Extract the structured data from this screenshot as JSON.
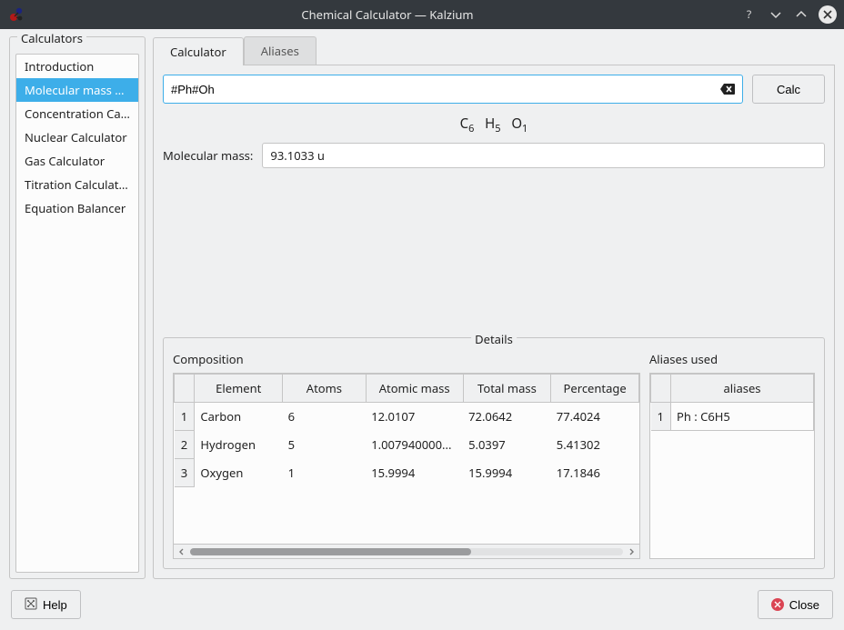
{
  "window": {
    "title": "Chemical Calculator — Kalzium"
  },
  "sidebar": {
    "group_label": "Calculators",
    "items": [
      {
        "label": "Introduction"
      },
      {
        "label": "Molecular mass Calc..."
      },
      {
        "label": "Concentration Calcul..."
      },
      {
        "label": "Nuclear Calculator"
      },
      {
        "label": "Gas Calculator"
      },
      {
        "label": "Titration Calculator"
      },
      {
        "label": "Equation Balancer"
      }
    ],
    "selected_index": 1
  },
  "tabs": {
    "items": [
      {
        "label": "Calculator"
      },
      {
        "label": "Aliases"
      }
    ],
    "active_index": 0
  },
  "calculator": {
    "input_value": "#Ph#Oh",
    "calc_button": "Calc",
    "formula_parts": [
      {
        "sym": "C",
        "sub": "6"
      },
      {
        "sym": "H",
        "sub": "5"
      },
      {
        "sym": "O",
        "sub": "1"
      }
    ],
    "mass_label": "Molecular mass:",
    "mass_value": "93.1033 u"
  },
  "details": {
    "group_label": "Details",
    "composition_label": "Composition",
    "aliases_label": "Aliases used",
    "columns": [
      "Element",
      "Atoms",
      "Atomic mass",
      "Total mass",
      "Percentage"
    ],
    "rows": [
      {
        "n": "1",
        "element": "Carbon",
        "atoms": "6",
        "atomic_mass": "12.0107",
        "total_mass": "72.0642",
        "percentage": "77.4024"
      },
      {
        "n": "2",
        "element": "Hydrogen",
        "atoms": "5",
        "atomic_mass": "1.007940000...",
        "total_mass": "5.0397",
        "percentage": "5.41302"
      },
      {
        "n": "3",
        "element": "Oxygen",
        "atoms": "1",
        "atomic_mass": "15.9994",
        "total_mass": "15.9994",
        "percentage": "17.1846"
      }
    ],
    "aliases_column": "aliases",
    "aliases_rows": [
      {
        "n": "1",
        "value": "Ph : C6H5"
      }
    ]
  },
  "footer": {
    "help": "Help",
    "close": "Close"
  }
}
